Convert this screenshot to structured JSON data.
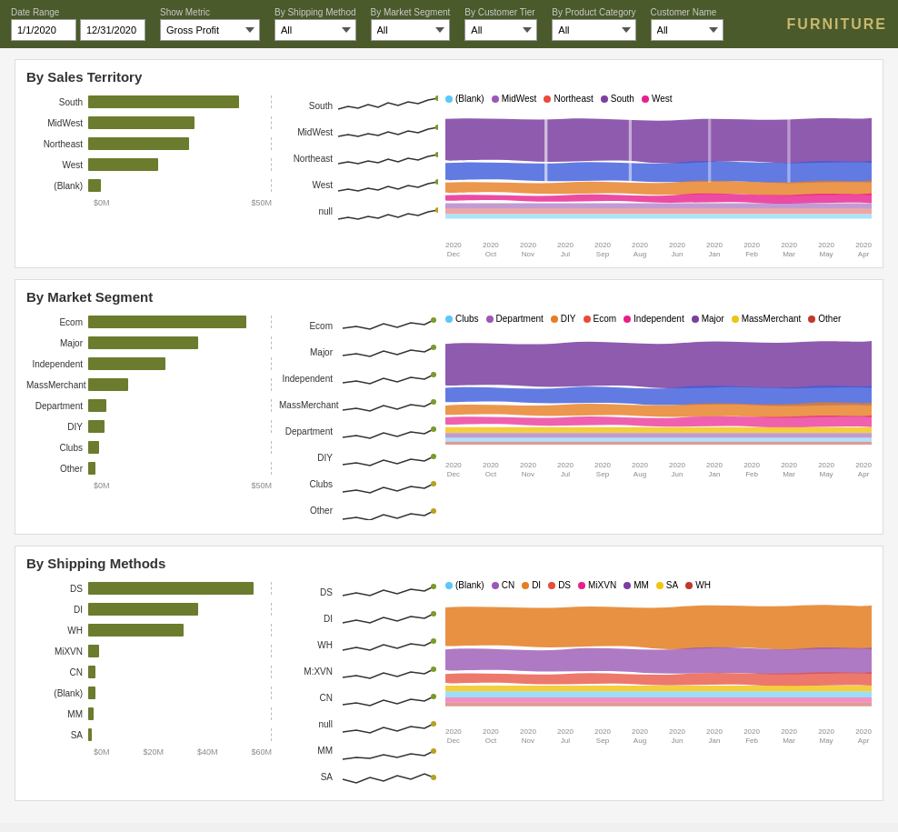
{
  "header": {
    "title": "FURNITURE",
    "filters": {
      "date_range_label": "Date Range",
      "date_start": "1/1/2020",
      "date_end": "12/31/2020",
      "show_metric_label": "Show Metric",
      "show_metric_value": "Gross Profit",
      "shipping_method_label": "By Shipping Method",
      "shipping_method_value": "All",
      "market_segment_label": "By Market Segment",
      "market_segment_value": "All",
      "customer_tier_label": "By Customer Tier",
      "customer_tier_value": "All",
      "product_category_label": "By Product Category",
      "product_category_value": "All",
      "customer_name_label": "Customer Name",
      "customer_name_value": "All"
    }
  },
  "sections": {
    "territory": {
      "title": "By Sales Territory",
      "bars": [
        {
          "label": "South",
          "pct": 82
        },
        {
          "label": "MidWest",
          "pct": 58
        },
        {
          "label": "Northeast",
          "pct": 55
        },
        {
          "label": "West",
          "pct": 38
        },
        {
          "label": "(Blank)",
          "pct": 7
        }
      ],
      "bar_axis": [
        "$0M",
        "$50M"
      ],
      "sparklines": [
        "South",
        "MidWest",
        "Northeast",
        "West",
        "null"
      ],
      "legend": [
        {
          "label": "(Blank)",
          "color": "#5bc8f5"
        },
        {
          "label": "MidWest",
          "color": "#9b59b6"
        },
        {
          "label": "Northeast",
          "color": "#e74c3c"
        },
        {
          "label": "South",
          "color": "#8e44ad"
        },
        {
          "label": "West",
          "color": "#e91e8c"
        }
      ],
      "axis_dates": [
        {
          "year": "2020",
          "month": "Dec"
        },
        {
          "year": "2020",
          "month": "Oct"
        },
        {
          "year": "2020",
          "month": "Nov"
        },
        {
          "year": "2020",
          "month": "Jul"
        },
        {
          "year": "2020",
          "month": "Sep"
        },
        {
          "year": "2020",
          "month": "Aug"
        },
        {
          "year": "2020",
          "month": "Jun"
        },
        {
          "year": "2020",
          "month": "Jan"
        },
        {
          "year": "2020",
          "month": "Feb"
        },
        {
          "year": "2020",
          "month": "Mar"
        },
        {
          "year": "2020",
          "month": "May"
        },
        {
          "year": "2020",
          "month": "Apr"
        }
      ]
    },
    "market": {
      "title": "By Market Segment",
      "bars": [
        {
          "label": "Ecom",
          "pct": 86
        },
        {
          "label": "Major",
          "pct": 60
        },
        {
          "label": "Independent",
          "pct": 42
        },
        {
          "label": "MassMerchant",
          "pct": 22
        },
        {
          "label": "Department",
          "pct": 10
        },
        {
          "label": "DIY",
          "pct": 9
        },
        {
          "label": "Clubs",
          "pct": 6
        },
        {
          "label": "Other",
          "pct": 4
        }
      ],
      "bar_axis": [
        "$0M",
        "$50M"
      ],
      "sparklines": [
        "Ecom",
        "Major",
        "Independent",
        "MassMerchant",
        "Department",
        "DIY",
        "Clubs",
        "Other"
      ],
      "legend": [
        {
          "label": "Clubs",
          "color": "#5bc8f5"
        },
        {
          "label": "Department",
          "color": "#9b59b6"
        },
        {
          "label": "DIY",
          "color": "#e67e22"
        },
        {
          "label": "Ecom",
          "color": "#e74c3c"
        },
        {
          "label": "Independent",
          "color": "#e91e8c"
        },
        {
          "label": "Major",
          "color": "#8e44ad"
        },
        {
          "label": "MassMerchant",
          "color": "#f1c40f"
        },
        {
          "label": "Other",
          "color": "#c0392b"
        }
      ],
      "axis_dates": [
        {
          "year": "2020",
          "month": "Dec"
        },
        {
          "year": "2020",
          "month": "Oct"
        },
        {
          "year": "2020",
          "month": "Nov"
        },
        {
          "year": "2020",
          "month": "Jul"
        },
        {
          "year": "2020",
          "month": "Sep"
        },
        {
          "year": "2020",
          "month": "Aug"
        },
        {
          "year": "2020",
          "month": "Jun"
        },
        {
          "year": "2020",
          "month": "Jan"
        },
        {
          "year": "2020",
          "month": "Feb"
        },
        {
          "year": "2020",
          "month": "Mar"
        },
        {
          "year": "2020",
          "month": "May"
        },
        {
          "year": "2020",
          "month": "Apr"
        }
      ]
    },
    "shipping": {
      "title": "By Shipping Methods",
      "bars": [
        {
          "label": "DS",
          "pct": 90
        },
        {
          "label": "DI",
          "pct": 60
        },
        {
          "label": "WH",
          "pct": 52
        },
        {
          "label": "MiXVN",
          "pct": 6
        },
        {
          "label": "CN",
          "pct": 4
        },
        {
          "label": "(Blank)",
          "pct": 4
        },
        {
          "label": "MM",
          "pct": 3
        },
        {
          "label": "SA",
          "pct": 2
        }
      ],
      "bar_axis": [
        "$0M",
        "$20M",
        "$40M",
        "$60M"
      ],
      "sparklines": [
        "DS",
        "DI",
        "WH",
        "M:XVN",
        "CN",
        "null",
        "MM",
        "SA"
      ],
      "legend": [
        {
          "label": "(Blank)",
          "color": "#5bc8f5"
        },
        {
          "label": "CN",
          "color": "#9b59b6"
        },
        {
          "label": "DI",
          "color": "#e67e22"
        },
        {
          "label": "DS",
          "color": "#e74c3c"
        },
        {
          "label": "MiXVN",
          "color": "#e91e8c"
        },
        {
          "label": "MM",
          "color": "#8e44ad"
        },
        {
          "label": "SA",
          "color": "#f1c40f"
        },
        {
          "label": "WH",
          "color": "#c0392b"
        }
      ],
      "axis_dates": [
        {
          "year": "2020",
          "month": "Dec"
        },
        {
          "year": "2020",
          "month": "Oct"
        },
        {
          "year": "2020",
          "month": "Nov"
        },
        {
          "year": "2020",
          "month": "Jul"
        },
        {
          "year": "2020",
          "month": "Sep"
        },
        {
          "year": "2020",
          "month": "Aug"
        },
        {
          "year": "2020",
          "month": "Jun"
        },
        {
          "year": "2020",
          "month": "Jan"
        },
        {
          "year": "2020",
          "month": "Feb"
        },
        {
          "year": "2020",
          "month": "Mar"
        },
        {
          "year": "2020",
          "month": "May"
        },
        {
          "year": "2020",
          "month": "Apr"
        }
      ]
    }
  }
}
